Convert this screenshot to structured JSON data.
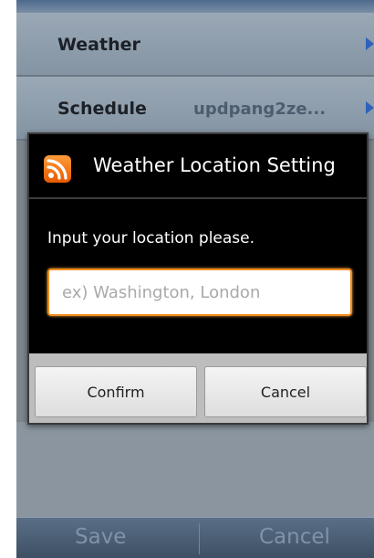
{
  "settings": {
    "rows": [
      {
        "label": "Weather",
        "value": ""
      },
      {
        "label": "Schedule",
        "value": "updpang2ze..."
      }
    ]
  },
  "dialog": {
    "title": "Weather Location Setting",
    "icon": "rss-icon",
    "message": "Input your location please.",
    "input": {
      "value": "",
      "placeholder": "ex) Washington, London"
    },
    "confirm_label": "Confirm",
    "cancel_label": "Cancel"
  },
  "bottom_bar": {
    "save_label": "Save",
    "cancel_label": "Cancel"
  },
  "colors": {
    "accent": "#f08c1e",
    "dialog_background": "#000000",
    "arrow": "#2f62b8"
  }
}
